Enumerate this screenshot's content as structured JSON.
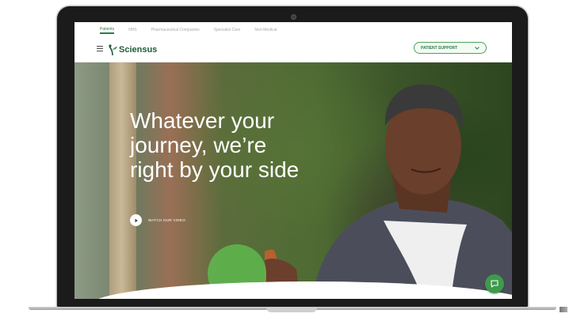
{
  "top_tabs": [
    "Patients",
    "NHS",
    "Pharmaceutical Companies",
    "Specialist Care",
    "Non-Medical"
  ],
  "active_tab_index": 0,
  "nav": {
    "logo_text": "Sciensus",
    "support_button_label": "PATIENT SUPPORT"
  },
  "hero": {
    "headline_lines": [
      "Whatever your",
      "journey, we’re",
      "right by your side"
    ],
    "watch_label": "WATCH OUR VIDEO"
  },
  "icons": {
    "menu": "hamburger-icon",
    "logo": "sciensus-leaf-icon",
    "dropdown": "chevron-down-icon",
    "play": "play-icon",
    "chat": "chat-icon"
  },
  "colors": {
    "brand_green": "#2d7a48",
    "accent_green": "#49a35c",
    "chat_green": "#3d9b4b",
    "laptop_bezel": "#1b1b1b"
  }
}
